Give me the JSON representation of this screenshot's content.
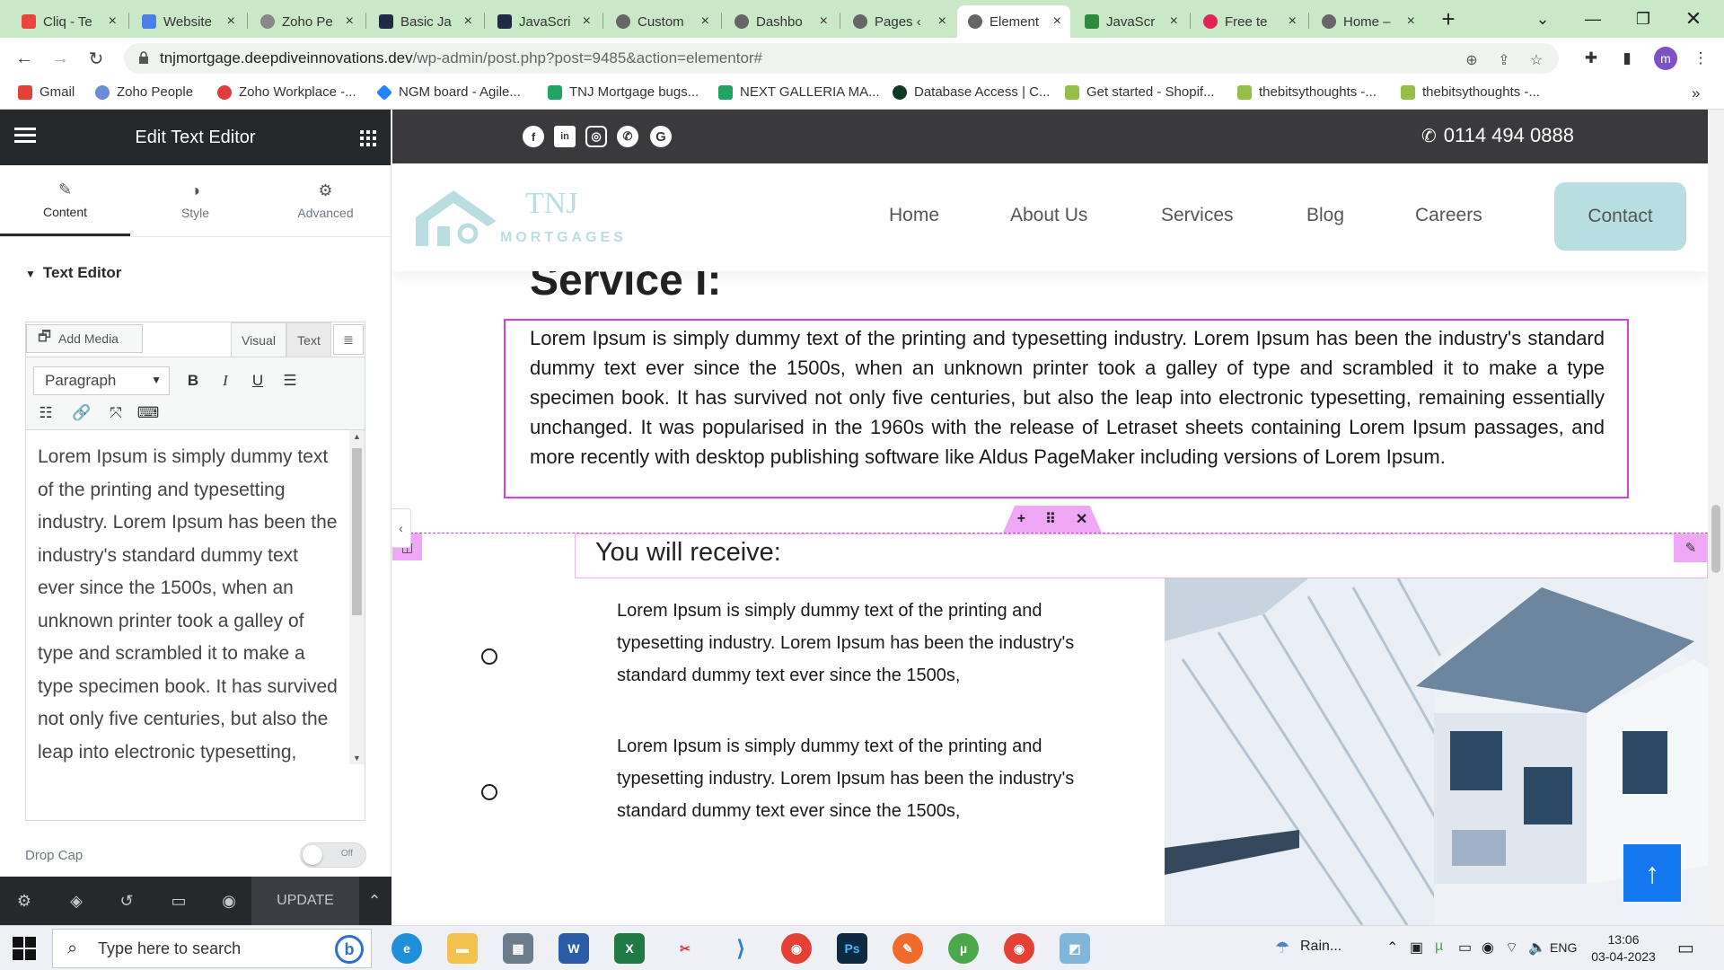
{
  "browser": {
    "tabs": [
      {
        "title": "Cliq - Te",
        "color": "#e8453c"
      },
      {
        "title": "Website",
        "color": "#4a7ee8"
      },
      {
        "title": "Zoho Pe",
        "color": "#888"
      },
      {
        "title": "Basic Ja",
        "color": "#1f2a44"
      },
      {
        "title": "JavaScri",
        "color": "#1f2a44"
      },
      {
        "title": "Custom",
        "color": "#666"
      },
      {
        "title": "Dashbo",
        "color": "#666"
      },
      {
        "title": "Pages ‹",
        "color": "#666"
      },
      {
        "title": "Element",
        "color": "#666"
      },
      {
        "title": "JavaScr",
        "color": "#2b8a3e"
      },
      {
        "title": "Free te",
        "color": "#e02454"
      },
      {
        "title": "Home –",
        "color": "#666"
      }
    ],
    "new_tab": "+",
    "url_host": "tnjmortgage.deepdiveinnovations.dev",
    "url_path": "/wp-admin/post.php?post=9485&action=elementor#",
    "profile_initial": "m",
    "bookmarks": [
      {
        "label": "Gmail",
        "color": "#e44134"
      },
      {
        "label": "Zoho People",
        "color": "#6a8cd8"
      },
      {
        "label": "Zoho Workplace -...",
        "color": "#e03c3c"
      },
      {
        "label": "NGM board - Agile...",
        "color": "#2684ff"
      },
      {
        "label": "TNJ Mortgage bugs...",
        "color": "#1fa463"
      },
      {
        "label": "NEXT GALLERIA MA...",
        "color": "#1fa463"
      },
      {
        "label": "Database Access | C...",
        "color": "#0b3b24"
      },
      {
        "label": "Get started - Shopif...",
        "color": "#95bf47"
      },
      {
        "label": "thebitsythoughts -...",
        "color": "#95bf47"
      },
      {
        "label": "thebitsythoughts -...",
        "color": "#95bf47"
      }
    ],
    "bookmarks_more": "»"
  },
  "panel": {
    "title": "Edit Text Editor",
    "tabs": [
      {
        "label": "Content",
        "icon": "✎"
      },
      {
        "label": "Style",
        "icon": "◑"
      },
      {
        "label": "Advanced",
        "icon": "⚙"
      }
    ],
    "section": "Text Editor",
    "add_media": "Add Media",
    "visual_tab": "Visual",
    "text_tab": "Text",
    "format": "Paragraph",
    "editor_text": "Lorem Ipsum is simply dummy text of the printing and typesetting industry. Lorem Ipsum has been the industry's standard dummy text ever since the 1500s, when an unknown printer took a galley of type and scrambled it to make a type specimen book. It has survived not only five centuries, but also the leap into electronic typesetting, remaining essentially unchanged.",
    "drop_cap_label": "Drop Cap",
    "drop_cap_state": "Off",
    "update_label": "UPDATE"
  },
  "site": {
    "phone": "0114 494 0888",
    "logo_mark": "TNJ",
    "logo_text": "MORTGAGES",
    "nav": [
      "Home",
      "About Us",
      "Services",
      "Blog",
      "Careers"
    ],
    "contact": "Contact",
    "service_title": "Service I:",
    "intro": "Lorem Ipsum is simply dummy text of the printing and typesetting industry. Lorem Ipsum has been the industry's standard dummy text ever since the 1500s, when an unknown printer took a galley of type and scrambled it to make a type specimen book. It has survived not only five centuries, but also the leap into electronic typesetting, remaining essentially unchanged. It was popularised in the 1960s with the release of Letraset sheets containing Lorem Ipsum passages, and more recently with desktop publishing software like Aldus PageMaker including versions of Lorem Ipsum.",
    "receive_title": "You will receive:",
    "bullets": [
      "Lorem Ipsum is simply dummy text of the printing and typesetting industry. Lorem Ipsum has been the industry's standard dummy text ever since the 1500s,",
      "Lorem Ipsum is simply dummy text of the printing and typesetting industry. Lorem Ipsum has been the industry's standard dummy text ever since the 1500s,"
    ]
  },
  "taskbar": {
    "search_placeholder": "Type here to search",
    "weather": "Rain...",
    "language": "ENG",
    "time": "13:06",
    "date": "03-04-2023"
  },
  "colors": {
    "accent_magenta": "#d63fe0",
    "contact_bg": "#b9dee2",
    "panel_dark": "#26292c",
    "backtop_blue": "#1478f0"
  }
}
